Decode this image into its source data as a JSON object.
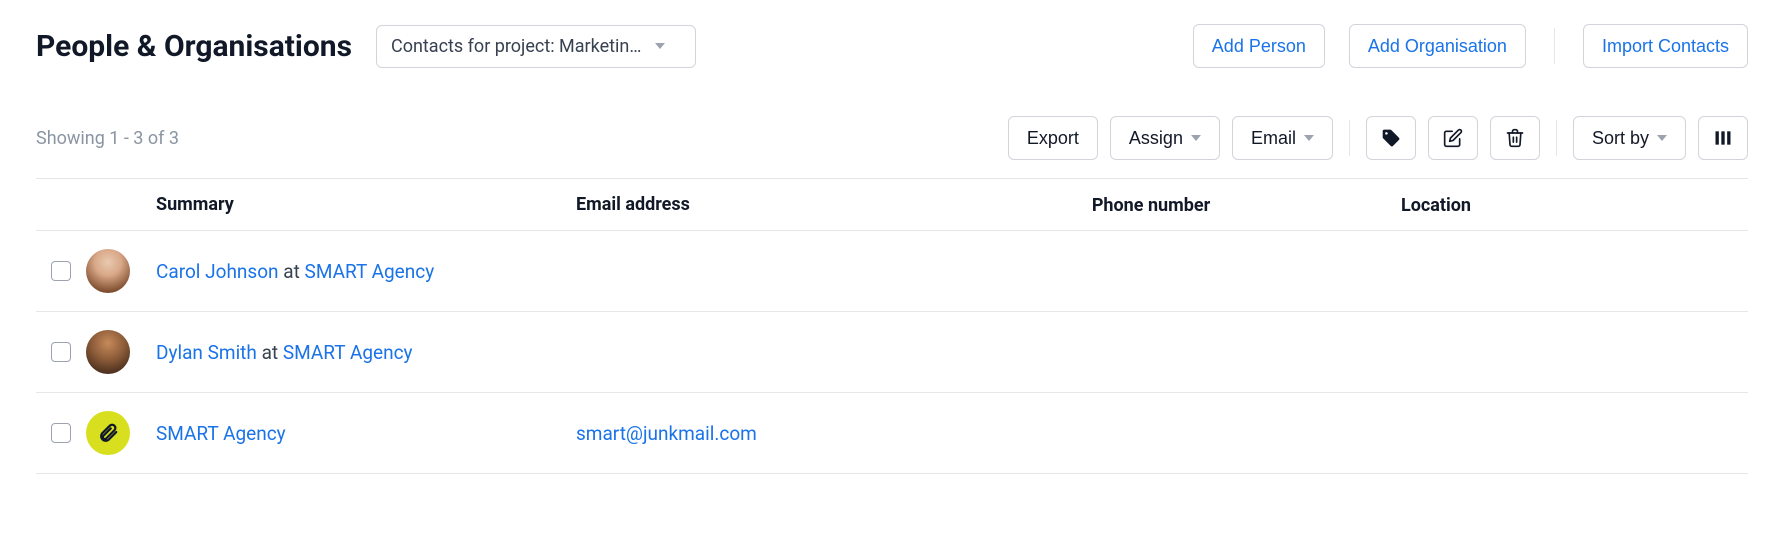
{
  "header": {
    "title": "People & Organisations",
    "filter_label": "Contacts for project: Marketin…",
    "add_person": "Add Person",
    "add_org": "Add Organisation",
    "import": "Import Contacts"
  },
  "toolbar": {
    "showing": "Showing 1 - 3 of 3",
    "export": "Export",
    "assign": "Assign",
    "email": "Email",
    "sort": "Sort by"
  },
  "columns": {
    "summary": "Summary",
    "email": "Email address",
    "phone": "Phone number",
    "location": "Location"
  },
  "rows": [
    {
      "type": "person",
      "avatar": "person1",
      "person_name": "Carol Johnson",
      "at": "at",
      "org_name": "SMART Agency",
      "email": "",
      "phone": "",
      "location": ""
    },
    {
      "type": "person",
      "avatar": "person2",
      "person_name": "Dylan Smith",
      "at": "at",
      "org_name": "SMART Agency",
      "email": "",
      "phone": "",
      "location": ""
    },
    {
      "type": "org",
      "avatar": "org",
      "person_name": "SMART Agency",
      "at": "",
      "org_name": "",
      "email": "smart@junkmail.com",
      "phone": "",
      "location": ""
    }
  ]
}
